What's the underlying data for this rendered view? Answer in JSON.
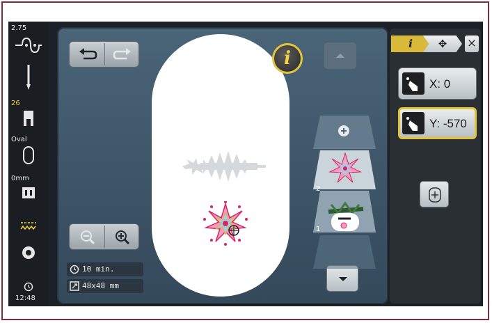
{
  "sidebar": {
    "tension_value": "2.75",
    "presser_foot_number": "26",
    "hoop_name": "Oval",
    "offset_value": "0mm",
    "time": "12:48"
  },
  "toolbar": {
    "undo_label": "",
    "redo_label": ""
  },
  "info_button": {
    "label": "i"
  },
  "status": {
    "time_estimate": "10 min.",
    "size": "48x48 mm"
  },
  "layers": {
    "items": [
      {
        "number": "2"
      },
      {
        "number": "1"
      }
    ]
  },
  "panel": {
    "tab_info": "i",
    "tab_move": "✥",
    "close": "×",
    "x_label": "X: 0",
    "y_label": "Y: -570"
  },
  "colors": {
    "accent_yellow": "#e2c43a",
    "frame": "#7a2d3d"
  }
}
